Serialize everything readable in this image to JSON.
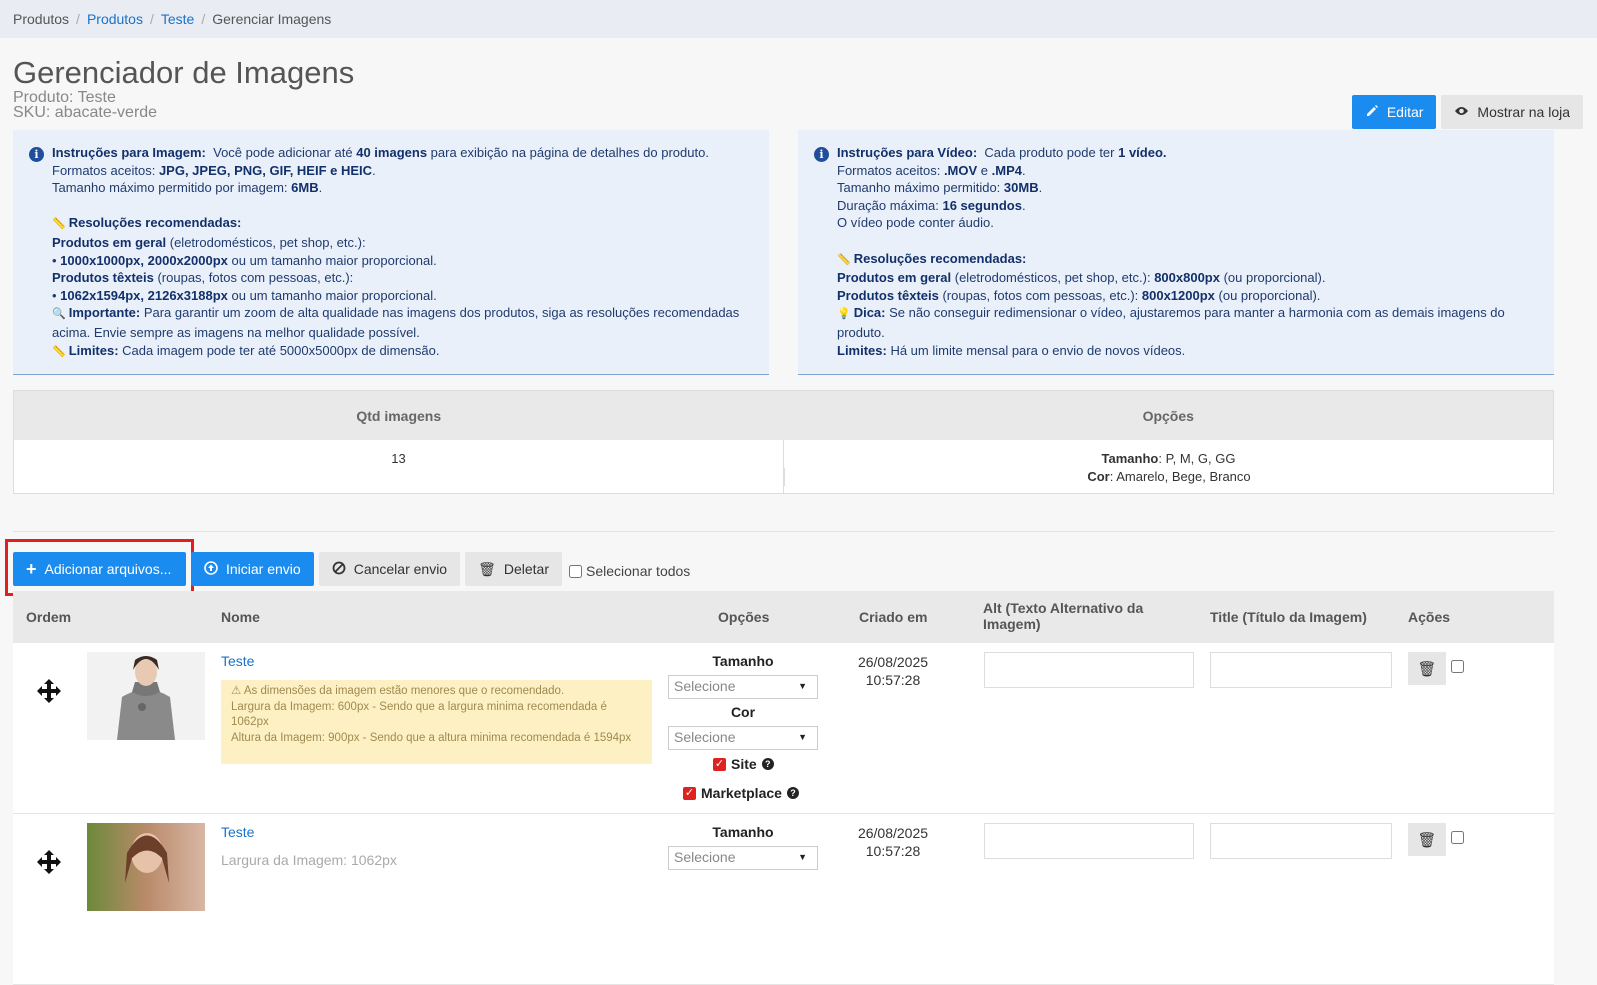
{
  "breadcrumb": {
    "item1": "Produtos",
    "item2": "Produtos",
    "item3": "Teste",
    "current": "Gerenciar Imagens"
  },
  "header": {
    "title": "Gerenciador de Imagens",
    "product": "Produto: Teste",
    "sku": "SKU: abacate-verde",
    "edit_label": "Editar",
    "show_label": "Mostrar na loja"
  },
  "image_info": {
    "title": "Instruções para Imagem:",
    "l1a": "Você pode adicionar até ",
    "l1b": "40 imagens",
    "l1c": " para exibição na página de detalhes do produto.",
    "l2a": "Formatos aceitos: ",
    "l2b": "JPG, JPEG, PNG, GIF, HEIF e HEIC",
    "l2c": ".",
    "l3a": "Tamanho máximo permitido por imagem: ",
    "l3b": "6MB",
    "l3c": ".",
    "res_title": "Resoluções recomendadas:",
    "g1a": "Produtos em geral",
    "g1b": " (eletrodomésticos, pet shop, etc.):",
    "g2a": "1000x1000px, 2000x2000px",
    "g2b": " ou um tamanho maior proporcional.",
    "t1a": "Produtos têxteis",
    "t1b": " (roupas, fotos com pessoas, etc.):",
    "t2a": "1062x1594px, 2126x3188px",
    "t2b": " ou um tamanho maior proporcional.",
    "imp_a": "Importante:",
    "imp_b": " Para garantir um zoom de alta qualidade nas imagens dos produtos, siga as resoluções recomendadas acima. Envie sempre as imagens na melhor qualidade possível.",
    "lim_a": "Limites:",
    "lim_b": " Cada imagem pode ter até 5000x5000px de dimensão."
  },
  "video_info": {
    "title": "Instruções para Vídeo:",
    "l1a": "Cada produto pode ter ",
    "l1b": "1 vídeo.",
    "l2a": "Formatos aceitos: ",
    "l2b": ".MOV",
    "l2c": " e ",
    "l2d": ".MP4",
    "l2e": ".",
    "l3a": "Tamanho máximo permitido: ",
    "l3b": "30MB",
    "l3c": ".",
    "l4a": "Duração máxima: ",
    "l4b": "16 segundos",
    "l4c": ".",
    "l5": "O vídeo pode conter áudio.",
    "res_title": "Resoluções recomendadas:",
    "g1a": "Produtos em geral",
    "g1b": " (eletrodomésticos, pet shop, etc.): ",
    "g1c": "800x800px",
    "g1d": " (ou proporcional).",
    "t1a": "Produtos têxteis",
    "t1b": " (roupas, fotos com pessoas, etc.): ",
    "t1c": "800x1200px",
    "t1d": " (ou proporcional).",
    "tip_a": "Dica:",
    "tip_b": " Se não conseguir redimensionar o vídeo, ajustaremos para manter a harmonia com as demais imagens do produto.",
    "lim_a": "Limites:",
    "lim_b": " Há um limite mensal para o envio de novos vídeos."
  },
  "stats": {
    "h1": "Qtd imagens",
    "h2": "Opções",
    "count": "13",
    "size_label": "Tamanho",
    "size_values": ": P, M, G, GG",
    "color_label": "Cor",
    "color_values": ": Amarelo, Bege, Branco"
  },
  "toolbar": {
    "add": "Adicionar arquivos...",
    "start": "Iniciar envio",
    "cancel": "Cancelar envio",
    "delete": "Deletar",
    "select_all": "Selecionar todos"
  },
  "columns": {
    "order": "Ordem",
    "name": "Nome",
    "options": "Opções",
    "created": "Criado em",
    "alt1": "Alt (Texto Alternativo da",
    "alt2": "Imagem)",
    "title": "Title (Título da Imagem)",
    "actions": "Ações"
  },
  "rows": [
    {
      "name": "Teste",
      "warn1": "As dimensões da imagem estão menores que o recomendado.",
      "warn2": "Largura da Imagem: 600px - Sendo que a largura minima recomendada é 1062px",
      "warn3": "Altura da Imagem: 900px - Sendo que a altura minima recomendada é 1594px",
      "size_label": "Tamanho",
      "size_value": "Selecione",
      "color_label": "Cor",
      "color_value": "Selecione",
      "site": "Site",
      "marketplace": "Marketplace",
      "date": "26/08/2025",
      "time": "10:57:28"
    },
    {
      "name": "Teste",
      "dim": "Largura da Imagem: 1062px",
      "size_label": "Tamanho",
      "size_value": "Selecione",
      "date": "26/08/2025",
      "time": "10:57:28"
    }
  ],
  "icons": {
    "info": "info-circle-icon",
    "move": "move-arrows-icon",
    "trash": "trash-icon",
    "warning": "warning-triangle-icon"
  },
  "colors": {
    "primary": "#1a8cf0",
    "info_bg": "#eaf0fa",
    "warning_bg": "#fdf1c4",
    "highlight": "#e02020"
  }
}
